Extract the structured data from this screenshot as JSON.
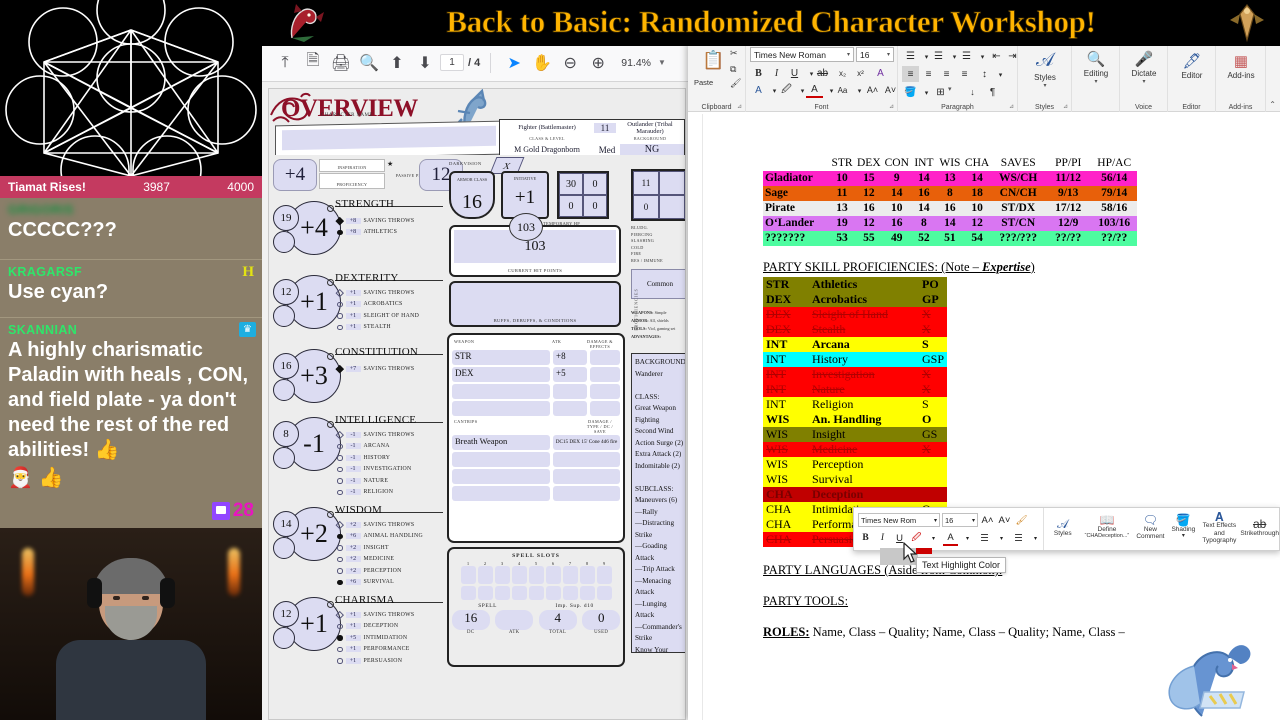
{
  "stream": {
    "title": "Back to Basic: Randomized Character Workshop!",
    "goal": {
      "label": "Tiamat Rises!",
      "current": "3987",
      "max": "4000"
    },
    "chat": [
      {
        "user": "GRIGORIS",
        "blurred": true,
        "text": "CCCCC???",
        "badge": "",
        "emotes": ""
      },
      {
        "user": "KRAGARSF",
        "blurred": false,
        "text": "Use cyan?",
        "badge": "H",
        "emotes": ""
      },
      {
        "user": "SKANNIAN",
        "blurred": false,
        "text": "A highly charismatic Paladin with heals , CON, and field plate - ya don't need the rest of the red abilities! 👍",
        "badge": "mod",
        "emotes": "🎅 👍"
      }
    ],
    "viewer_count": "28"
  },
  "pdf": {
    "toolbar": {
      "page_current": "1",
      "page_total": "/ 4",
      "zoom": "91.4%",
      "icons": [
        "upload-icon",
        "save-icon",
        "print-icon",
        "zoom-text-icon",
        "page-up-icon",
        "page-down-icon",
        "select-tool-icon",
        "hand-tool-icon",
        "zoom-out-icon",
        "zoom-in-icon",
        "chevron-down-icon"
      ]
    },
    "sheet": {
      "section_title": "OVERVIEW",
      "character_name_label": "CHARACTER NAME",
      "character_name": "",
      "class_level": "Fighter (Battlemaster)",
      "level": "11",
      "background": "Outlander (Tribal Marauder)",
      "class_label": "CLASS &  LEVEL",
      "background_label": "BACKGROUND",
      "race_size": "M Gold Dragonborn",
      "size": "Med",
      "alignment": "NG",
      "race_label": "RACE & SIZE",
      "alignment_label": "ALIGNMENT",
      "proficiency_bonus": "+4",
      "proficiency_label": "PROFICIENCY",
      "inspiration_label": "INSPIRATION",
      "passive_perception": "12",
      "passive_label": "PASSIVE PERCEPTION",
      "darkvision_label": "DARKVISION",
      "darkvision": "X",
      "armor_class_label": "ARMOR CLASS",
      "armor_class": "16",
      "initiative_label": "INITIATIVE",
      "initiative": "+1",
      "temp_hp_label": "TEMPORARY HP",
      "temp_grid": [
        "30",
        "0",
        "0",
        "0"
      ],
      "hp_badge": "103",
      "current_hp": "103",
      "current_hp_label": "CURRENT HIT POINTS",
      "buffs_label": "BUFFS, DEBUFFS, & CONDITIONS",
      "abilities": [
        {
          "name": "STRENGTH",
          "score": "19",
          "mod": "+4",
          "skills": [
            {
              "mod": "+8",
              "name": "SAVING THROWS",
              "marker": "diamond-filled"
            },
            {
              "mod": "+8",
              "name": "ATHLETICS",
              "marker": "filled"
            }
          ]
        },
        {
          "name": "DEXTERITY",
          "score": "12",
          "mod": "+1",
          "skills": [
            {
              "mod": "+1",
              "name": "SAVING THROWS",
              "marker": "diamond"
            },
            {
              "mod": "+1",
              "name": "ACROBATICS",
              "marker": "open"
            },
            {
              "mod": "+1",
              "name": "SLEIGHT OF HAND",
              "marker": "open"
            },
            {
              "mod": "+1",
              "name": "STEALTH",
              "marker": "open"
            }
          ]
        },
        {
          "name": "CONSTITUTION",
          "score": "16",
          "mod": "+3",
          "skills": [
            {
              "mod": "+7",
              "name": "SAVING THROWS",
              "marker": "diamond-filled"
            }
          ]
        },
        {
          "name": "INTELLIGENCE",
          "score": "8",
          "mod": "-1",
          "skills": [
            {
              "mod": "-1",
              "name": "SAVING THROWS",
              "marker": "diamond"
            },
            {
              "mod": "-1",
              "name": "ARCANA",
              "marker": "open"
            },
            {
              "mod": "-1",
              "name": "HISTORY",
              "marker": "open"
            },
            {
              "mod": "-1",
              "name": "INVESTIGATION",
              "marker": "open"
            },
            {
              "mod": "-1",
              "name": "NATURE",
              "marker": "open"
            },
            {
              "mod": "-1",
              "name": "RELIGION",
              "marker": "open"
            }
          ]
        },
        {
          "name": "WISDOM",
          "score": "14",
          "mod": "+2",
          "skills": [
            {
              "mod": "+2",
              "name": "SAVING THROWS",
              "marker": "diamond"
            },
            {
              "mod": "+6",
              "name": "ANIMAL HANDLING",
              "marker": "filled"
            },
            {
              "mod": "+2",
              "name": "INSIGHT",
              "marker": "open"
            },
            {
              "mod": "+2",
              "name": "MEDICINE",
              "marker": "open"
            },
            {
              "mod": "+2",
              "name": "PERCEPTION",
              "marker": "open"
            },
            {
              "mod": "+6",
              "name": "SURVIVAL",
              "marker": "filled"
            }
          ]
        },
        {
          "name": "CHARISMA",
          "score": "12",
          "mod": "+1",
          "skills": [
            {
              "mod": "+1",
              "name": "SAVING THROWS",
              "marker": "diamond"
            },
            {
              "mod": "+1",
              "name": "DECEPTION",
              "marker": "open"
            },
            {
              "mod": "+5",
              "name": "INTIMIDATION",
              "marker": "filled"
            },
            {
              "mod": "+1",
              "name": "PERFORMANCE",
              "marker": "open"
            },
            {
              "mod": "+1",
              "name": "PERSUASION",
              "marker": "open"
            }
          ]
        }
      ],
      "weapon_headers": {
        "weapon": "WEAPON",
        "atk": "ATK",
        "dmg": "DAMAGE & EFFECTS"
      },
      "weapons": [
        {
          "name": "STR",
          "atk": "+8",
          "dmg": ""
        },
        {
          "name": "DEX",
          "atk": "+5",
          "dmg": ""
        },
        {
          "name": "",
          "atk": "",
          "dmg": ""
        },
        {
          "name": "",
          "atk": "",
          "dmg": ""
        }
      ],
      "cantrip_headers": {
        "cantrips": "CANTRIPS",
        "dmg": "DAMAGE / TYPE / DC / SAVE"
      },
      "cantrips": [
        {
          "name": "Breath Weapon",
          "dmg": "DC15 DEX 15' Cone 4d6 fire"
        },
        {
          "name": "",
          "dmg": ""
        },
        {
          "name": "",
          "dmg": ""
        }
      ],
      "spell_slots_label": "SPELL SLOTS",
      "spell_slot_numbers": [
        "1",
        "2",
        "3",
        "4",
        "5",
        "6",
        "7",
        "8",
        "9"
      ],
      "spell_label": "SPELL",
      "superiority_label": "Imp. Sup. d10",
      "spell_dc": "16",
      "spell_atk": "",
      "sup_total": "4",
      "sup_used": "0",
      "sp_labels": [
        "DC",
        "ATK",
        "TOTAL",
        "USED"
      ],
      "total_label": "TOTAL",
      "used_label": "USED",
      "damage_types": [
        "BLUDG.",
        "PIERCING",
        "SLASHING",
        "COLD",
        "FIRE",
        "RES / IMMUNE"
      ],
      "common_lang": "Common",
      "proficiencies_label": "PROFICIENCIES",
      "prof_rows": [
        {
          "label": "WEAPONS:",
          "value": "Simple"
        },
        {
          "label": "ARMOR:",
          "value": "All, shields"
        },
        {
          "label": "TOOLS:",
          "value": "Viol, gaming set"
        },
        {
          "label": "ADVANTAGES:",
          "value": ""
        }
      ],
      "features": "BACKGROUND:\nWanderer\n\nCLASS:\nGreat Weapon Fighting\nSecond Wind\nAction Surge (2)\nExtra Attack (2)\nIndomitable (2)\n\nSUBCLASS:\nManeuvers (6)\n—Rally\n—Distracting Strike\n—Goading Attack\n—Trip Attack\n—Menacing Attack\n—Lunging Attack\n—Commander's Strike\nKnow Your Enemy"
    }
  },
  "word": {
    "ribbon": {
      "clipboard_label": "Clipboard",
      "paste_label": "Paste",
      "font_label": "Font",
      "font_name": "Times New Roman",
      "font_size": "16",
      "paragraph_label": "Paragraph",
      "styles_label": "Styles",
      "styles_button": "Styles",
      "editing_label": "Editing",
      "voice_label": "Voice",
      "dictate_label": "Dictate",
      "editor_group_label": "Editor",
      "editor_button": "Editor",
      "addins_label": "Add-ins",
      "addins_button": "Add-ins"
    },
    "mini_toolbar": {
      "font_name": "Times New Rom",
      "font_size": "16",
      "grow_font": "A˄",
      "shrink_font": "A˅",
      "format_painter": "format-painter-icon",
      "styles": "Styles",
      "define": "Define",
      "define_sub": "“CHADeception...”",
      "new_comment": "New Comment",
      "shading": "Shading",
      "text_effects": "Text Effects and Typography",
      "strikethrough": "Strikethrough",
      "bold": "B",
      "italic": "I",
      "underline": "U",
      "tooltip": "Text Highlight Color"
    },
    "doc": {
      "stat_table": {
        "headers": [
          "",
          "STR",
          "DEX",
          "CON",
          "INT",
          "WIS",
          "CHA",
          "SAVES",
          "PP/PI",
          "HP/AC"
        ],
        "rows": [
          {
            "name": "Gladiator",
            "str": "10",
            "dex": "15",
            "con": "9",
            "int": "14",
            "wis": "13",
            "cha": "14",
            "saves": "WS/CH",
            "pp": "11/12",
            "hp": "56/14",
            "color": "#ff22c8"
          },
          {
            "name": "Sage",
            "str": "11",
            "dex": "12",
            "con": "14",
            "int": "16",
            "wis": "8",
            "cha": "18",
            "saves": "CN/CH",
            "pp": "9/13",
            "hp": "79/14",
            "color": "#e8600a"
          },
          {
            "name": "Pirate",
            "str": "13",
            "dex": "16",
            "con": "10",
            "int": "14",
            "wis": "16",
            "cha": "10",
            "saves": "ST/DX",
            "pp": "17/12",
            "hp": "58/16",
            "color": "#ececec"
          },
          {
            "name": "O‘Lander",
            "str": "19",
            "dex": "12",
            "con": "16",
            "int": "8",
            "wis": "14",
            "cha": "12",
            "saves": "ST/CN",
            "pp": "12/9",
            "hp": "103/16",
            "color": "#d976f2"
          },
          {
            "name": "???????",
            "str": "53",
            "dex": "55",
            "con": "49",
            "int": "52",
            "wis": "51",
            "cha": "54",
            "saves": "???/???",
            "pp": "??/??",
            "hp": "??/??",
            "color": "#4dfca0"
          }
        ]
      },
      "skill_head_1": "PARTY SKILL PROFICIENCIES: (Note – ",
      "skill_head_em": "Expertise",
      "skill_head_2": ")",
      "skills": [
        {
          "abil": "STR",
          "name": "Athletics",
          "tag": "PO",
          "bg": "#808000",
          "fg": "#000000",
          "bold": true,
          "strike": false
        },
        {
          "abil": "DEX",
          "name": "Acrobatics",
          "tag": "GP",
          "bg": "#808000",
          "fg": "#000000",
          "bold": true,
          "strike": false
        },
        {
          "abil": "DEX",
          "name": "Sleight of Hand",
          "tag": "X",
          "bg": "#ff0000",
          "fg": "#b00000",
          "bold": false,
          "strike": true
        },
        {
          "abil": "DEX",
          "name": "Stealth",
          "tag": "X",
          "bg": "#ff0000",
          "fg": "#b00000",
          "bold": false,
          "strike": true
        },
        {
          "abil": "INT",
          "name": "Arcana",
          "tag": "S",
          "bg": "#ffff00",
          "fg": "#000000",
          "bold": true,
          "strike": false
        },
        {
          "abil": "INT",
          "name": "History",
          "tag": "GSP",
          "bg": "#00ffff",
          "fg": "#000000",
          "bold": false,
          "strike": false
        },
        {
          "abil": "INT",
          "name": "Investigation",
          "tag": "X",
          "bg": "#ff0000",
          "fg": "#b00000",
          "bold": false,
          "strike": true
        },
        {
          "abil": "INT",
          "name": "Nature",
          "tag": "X",
          "bg": "#ff0000",
          "fg": "#b00000",
          "bold": false,
          "strike": true
        },
        {
          "abil": "INT",
          "name": "Religion",
          "tag": "S",
          "bg": "#ffff00",
          "fg": "#000000",
          "bold": false,
          "strike": false
        },
        {
          "abil": "WIS",
          "name": "An. Handling",
          "tag": "O",
          "bg": "#ffff00",
          "fg": "#000000",
          "bold": true,
          "strike": false
        },
        {
          "abil": "WIS",
          "name": "Insight",
          "tag": "GS",
          "bg": "#808000",
          "fg": "#000000",
          "bold": false,
          "strike": false
        },
        {
          "abil": "WIS",
          "name": "Medicine",
          "tag": "X",
          "bg": "#ff0000",
          "fg": "#b00000",
          "bold": false,
          "strike": true
        },
        {
          "abil": "WIS",
          "name": "Perception",
          "tag": "",
          "bg": "#ffff00",
          "fg": "#000000",
          "bold": false,
          "strike": false
        },
        {
          "abil": "WIS",
          "name": "Survival",
          "tag": "",
          "bg": "#ffff00",
          "fg": "#000000",
          "bold": false,
          "strike": false
        },
        {
          "abil": "CHA",
          "name": "Deception",
          "tag": "",
          "bg": "#c00000",
          "fg": "#7a0000",
          "bold": true,
          "strike": false
        },
        {
          "abil": "CHA",
          "name": "Intimidation",
          "tag": "O",
          "bg": "#ffff00",
          "fg": "#000000",
          "bold": false,
          "strike": false
        },
        {
          "abil": "CHA",
          "name": "Performance",
          "tag": "G",
          "bg": "#ffff00",
          "fg": "#000000",
          "bold": false,
          "strike": false
        },
        {
          "abil": "CHA",
          "name": "Persuasion",
          "tag": "X",
          "bg": "#ff0000",
          "fg": "#b00000",
          "bold": false,
          "strike": true
        }
      ],
      "languages_head": "PARTY LANGUAGES (Aside from Common):",
      "tools_head": "PARTY TOOLS:",
      "roles_label": "ROLES:",
      "roles_text": " Name, Class – Quality; Name, Class – Quality; Name, Class –"
    }
  }
}
